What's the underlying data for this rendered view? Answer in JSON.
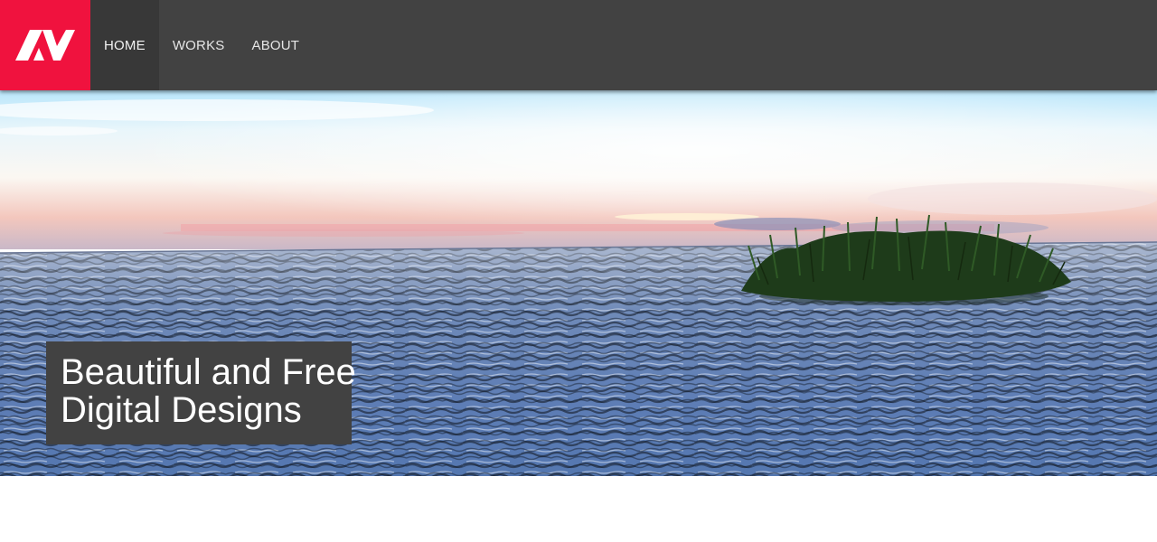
{
  "header": {
    "logo": {
      "text": "AV",
      "icon": "av-logo",
      "bg_color": "#f0123e"
    },
    "nav": [
      {
        "label": "HOME",
        "active": true
      },
      {
        "label": "WORKS",
        "active": false
      },
      {
        "label": "ABOUT",
        "active": false
      }
    ],
    "bg_color": "#424242"
  },
  "hero": {
    "image": "sunset-sea-grass-island",
    "caption": {
      "line1": "Beautiful and Free",
      "line2": "Digital Designs"
    }
  }
}
